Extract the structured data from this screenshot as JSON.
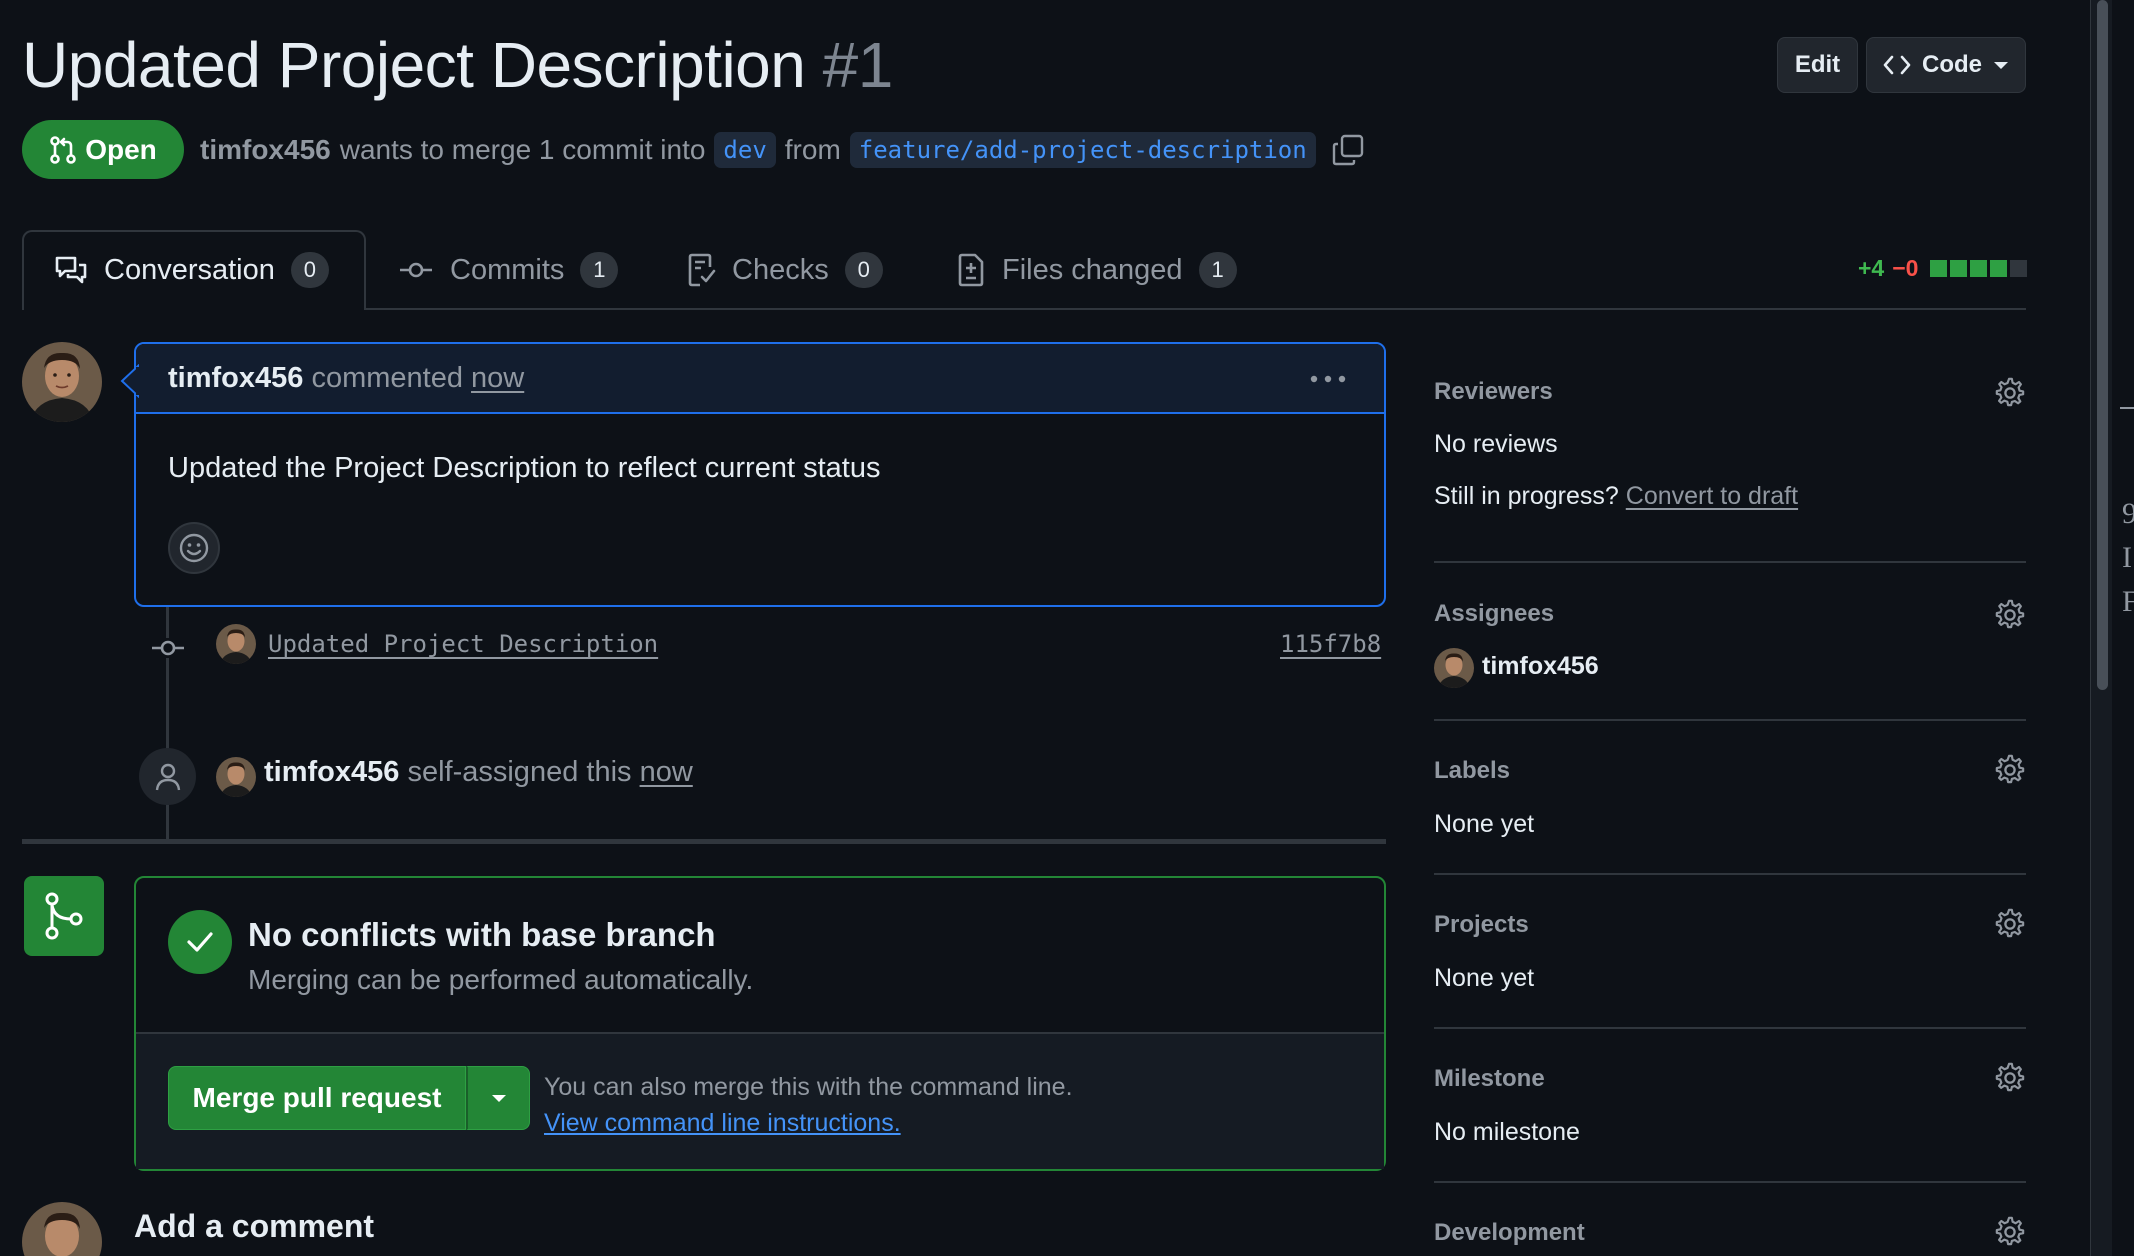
{
  "pr": {
    "title": "Updated Project Description",
    "number": "#1",
    "state": "Open",
    "author": "timfox456",
    "merge_text_1": "wants to merge 1 commit into",
    "base_branch": "dev",
    "merge_text_2": "from",
    "head_branch": "feature/add-project-description"
  },
  "header_buttons": {
    "edit": "Edit",
    "code": "Code"
  },
  "tabs": [
    {
      "label": "Conversation",
      "count": "0",
      "icon": "comment-discussion-icon"
    },
    {
      "label": "Commits",
      "count": "1",
      "icon": "commit-icon"
    },
    {
      "label": "Checks",
      "count": "0",
      "icon": "checklist-icon"
    },
    {
      "label": "Files changed",
      "count": "1",
      "icon": "file-diff-icon"
    }
  ],
  "diffstat": {
    "additions": "+4",
    "deletions": "−0",
    "blocks": [
      "#2ea043",
      "#2ea043",
      "#2ea043",
      "#2ea043",
      "#30363d"
    ]
  },
  "comment": {
    "author": "timfox456",
    "action": "commented",
    "time": "now",
    "body": "Updated the Project Description to reflect current status"
  },
  "commit": {
    "message": "Updated Project Description",
    "sha": "115f7b8"
  },
  "event": {
    "author": "timfox456",
    "action": "self-assigned this",
    "time": "now"
  },
  "merge": {
    "title": "No conflicts with base branch",
    "subtitle": "Merging can be performed automatically.",
    "button": "Merge pull request",
    "cli_text": "You can also merge this with the command line.",
    "cli_link": "View command line instructions."
  },
  "add_comment": "Add a comment",
  "sidebar": {
    "reviewers": {
      "label": "Reviewers",
      "value": "No reviews",
      "draft_prefix": "Still in progress?",
      "draft_link": "Convert to draft"
    },
    "assignees": {
      "label": "Assignees",
      "value": "timfox456"
    },
    "labels": {
      "label": "Labels",
      "value": "None yet"
    },
    "projects": {
      "label": "Projects",
      "value": "None yet"
    },
    "milestone": {
      "label": "Milestone",
      "value": "No milestone"
    },
    "development": {
      "label": "Development"
    }
  },
  "edge_strip": {
    "lines": [
      "9",
      "I",
      "F"
    ]
  },
  "colors": {
    "accent_green": "#238636",
    "link_blue": "#4493f8",
    "focus_blue": "#1f6feb",
    "background": "#0d1117"
  }
}
